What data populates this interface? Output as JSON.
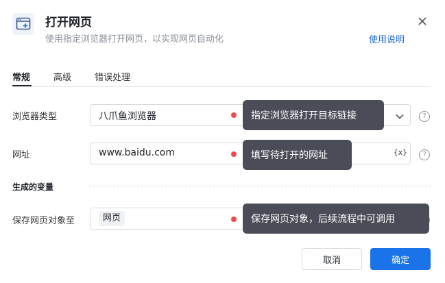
{
  "header": {
    "title": "打开网页",
    "subtitle": "使用指定浏览器打开网页，以实现网页自动化",
    "help_link": "使用说明",
    "icon": "browser-plus-icon"
  },
  "tabs": [
    {
      "label": "常规",
      "active": true
    },
    {
      "label": "高级",
      "active": false
    },
    {
      "label": "错误处理",
      "active": false
    }
  ],
  "fields": {
    "browser_type": {
      "label": "浏览器类型",
      "value": "八爪鱼浏览器"
    },
    "url": {
      "label": "网址",
      "value": "www.baidu.com",
      "var_icon": "{x}"
    },
    "section_label": "生成的变量",
    "save_to": {
      "label": "保存网页对象至",
      "tag": "网页"
    }
  },
  "tooltips": {
    "browser_type": "指定浏览器打开目标链接",
    "url": "填写待打开的网址",
    "save_to": "保存网页对象，后续流程中可调用"
  },
  "buttons": {
    "cancel": "取消",
    "confirm": "确定"
  },
  "colors": {
    "accent": "#1a73e8",
    "link": "#1a66d6",
    "tooltip_bg": "#4a4d57",
    "marker": "#f04a4a"
  }
}
